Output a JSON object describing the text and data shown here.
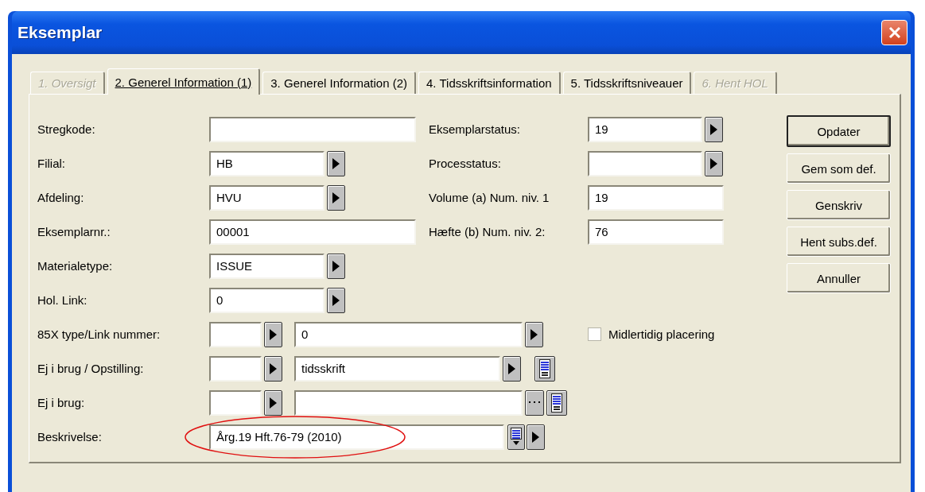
{
  "window": {
    "title": "Eksemplar"
  },
  "tabs": [
    {
      "label": "1. Oversigt",
      "selected": false,
      "disabled": true
    },
    {
      "label": "2. Generel Information (1)",
      "selected": true,
      "disabled": false
    },
    {
      "label": "3. Generel Information (2)",
      "selected": false,
      "disabled": false
    },
    {
      "label": "4. Tidsskriftsinformation",
      "selected": false,
      "disabled": false
    },
    {
      "label": "5. Tidsskriftsniveauer",
      "selected": false,
      "disabled": false
    },
    {
      "label": "6. Hent HOL",
      "selected": false,
      "disabled": true
    }
  ],
  "fields_left": [
    {
      "label": "Stregkode:",
      "kind": "text"
    },
    {
      "label": "Filial:",
      "kind": "lookup",
      "value": "HB"
    },
    {
      "label": "Afdeling:",
      "kind": "lookup",
      "value": "HVU"
    },
    {
      "label": "Eksemplarnr.:",
      "kind": "text",
      "value": "00001"
    },
    {
      "label": "Materialetype:",
      "kind": "lookup",
      "value": "ISSUE"
    },
    {
      "label": "Hol. Link:",
      "kind": "lookup",
      "value": "0"
    }
  ],
  "fields_right": [
    {
      "label": "Eksemplarstatus:",
      "kind": "lookup",
      "value": "19"
    },
    {
      "label": "Processtatus:",
      "kind": "lookup"
    },
    {
      "label": "Volume (a) Num. niv. 1",
      "kind": "text",
      "value": "19"
    },
    {
      "label": "Hæfte (b) Num. niv. 2:",
      "kind": "text",
      "value": "76"
    }
  ],
  "link_rows": [
    {
      "label": "85X type/Link nummer:",
      "kind": "arrow",
      "value": "0"
    },
    {
      "label": "Ej i brug / Opstilling:",
      "kind": "arrow-list",
      "value": "tidsskrift"
    },
    {
      "label": "Ej i brug:",
      "kind": "ellipsis-list"
    }
  ],
  "checkbox": {
    "label": "Midlertidig placering",
    "checked": false
  },
  "description": {
    "label": "Beskrivelse:",
    "value": "Årg.19 Hft.76-79 (2010)"
  },
  "buttons": [
    {
      "label": "Opdater",
      "default": true
    },
    {
      "label": "Gem som def.",
      "default": false
    },
    {
      "label": "Genskriv",
      "default": false
    },
    {
      "label": "Hent subs.def.",
      "default": false
    },
    {
      "label": "Annuller",
      "default": false
    }
  ]
}
